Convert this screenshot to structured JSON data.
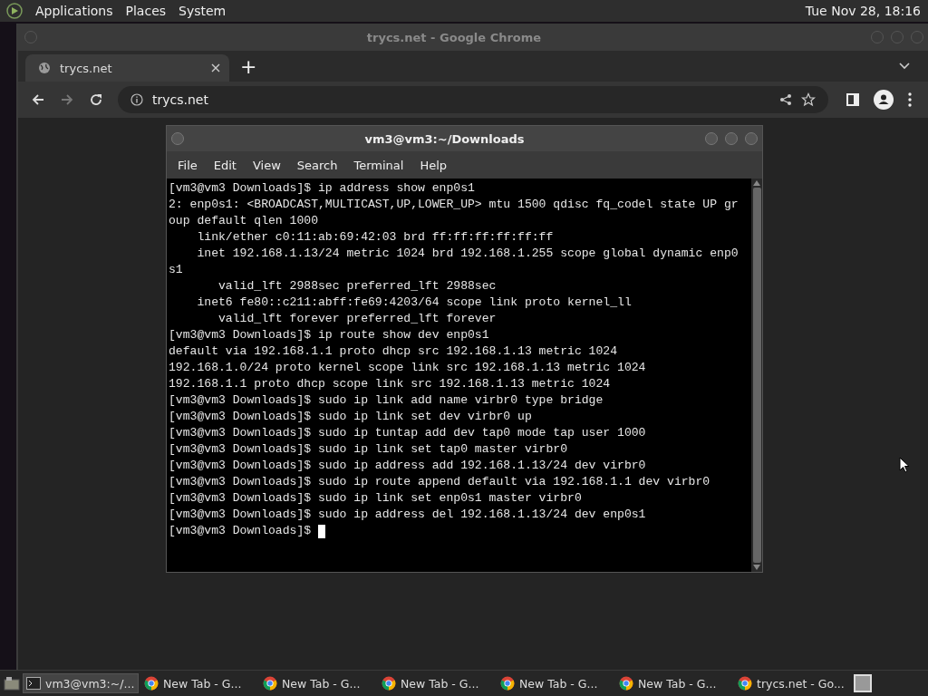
{
  "top_panel": {
    "menus": [
      "Applications",
      "Places",
      "System"
    ],
    "clock": "Tue Nov 28, 18:16"
  },
  "browser": {
    "title": "trycs.net - Google Chrome",
    "tabs": [
      {
        "label": "trycs.net",
        "selected": true
      }
    ],
    "new_tab": "+",
    "address": "trycs.net"
  },
  "terminal": {
    "title": "vm3@vm3:~/Downloads",
    "menus": [
      "File",
      "Edit",
      "View",
      "Search",
      "Terminal",
      "Help"
    ],
    "lines": [
      "[vm3@vm3 Downloads]$ ip address show enp0s1",
      "2: enp0s1: <BROADCAST,MULTICAST,UP,LOWER_UP> mtu 1500 qdisc fq_codel state UP gr",
      "oup default qlen 1000",
      "    link/ether c0:11:ab:69:42:03 brd ff:ff:ff:ff:ff:ff",
      "    inet 192.168.1.13/24 metric 1024 brd 192.168.1.255 scope global dynamic enp0",
      "s1",
      "       valid_lft 2988sec preferred_lft 2988sec",
      "    inet6 fe80::c211:abff:fe69:4203/64 scope link proto kernel_ll",
      "       valid_lft forever preferred_lft forever",
      "[vm3@vm3 Downloads]$ ip route show dev enp0s1",
      "default via 192.168.1.1 proto dhcp src 192.168.1.13 metric 1024",
      "192.168.1.0/24 proto kernel scope link src 192.168.1.13 metric 1024",
      "192.168.1.1 proto dhcp scope link src 192.168.1.13 metric 1024",
      "[vm3@vm3 Downloads]$ sudo ip link add name virbr0 type bridge",
      "[vm3@vm3 Downloads]$ sudo ip link set dev virbr0 up",
      "[vm3@vm3 Downloads]$ sudo ip tuntap add dev tap0 mode tap user 1000",
      "[vm3@vm3 Downloads]$ sudo ip link set tap0 master virbr0",
      "[vm3@vm3 Downloads]$ sudo ip address add 192.168.1.13/24 dev virbr0",
      "[vm3@vm3 Downloads]$ sudo ip route append default via 192.168.1.1 dev virbr0",
      "[vm3@vm3 Downloads]$ sudo ip link set enp0s1 master virbr0",
      "[vm3@vm3 Downloads]$ sudo ip address del 192.168.1.13/24 dev enp0s1"
    ],
    "prompt": "[vm3@vm3 Downloads]$"
  },
  "taskbar": [
    {
      "kind": "terminal",
      "label": "vm3@vm3:~/...",
      "selected": true
    },
    {
      "kind": "chrome",
      "label": "New Tab - G...",
      "selected": false
    },
    {
      "kind": "chrome",
      "label": "New Tab - G...",
      "selected": false
    },
    {
      "kind": "chrome",
      "label": "New Tab - G...",
      "selected": false
    },
    {
      "kind": "chrome",
      "label": "New Tab - G...",
      "selected": false
    },
    {
      "kind": "chrome",
      "label": "New Tab - G...",
      "selected": false
    },
    {
      "kind": "chrome",
      "label": "trycs.net - Go...",
      "selected": false
    }
  ]
}
